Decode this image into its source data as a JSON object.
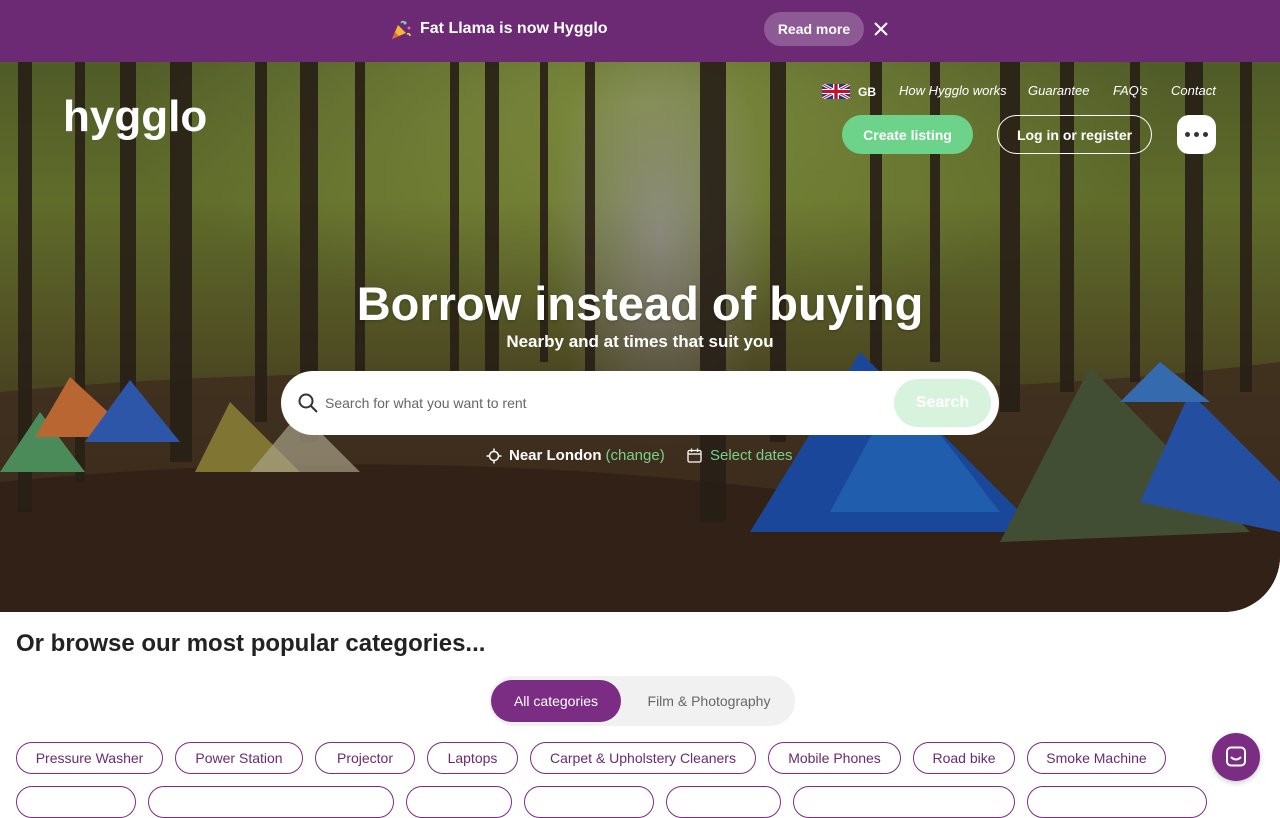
{
  "announcement": {
    "emoji": "party-popper-icon",
    "text": "Fat Llama is now Hygglo",
    "read_more": "Read more"
  },
  "header": {
    "logo": "hygglo",
    "region": "GB",
    "nav": [
      "How Hygglo works",
      "Guarantee",
      "FAQ's",
      "Contact"
    ],
    "create_listing": "Create listing",
    "login": "Log in or register"
  },
  "hero": {
    "headline": "Borrow instead of buying",
    "subhead": "Nearby and at times that suit you",
    "search_placeholder": "Search for what you want to rent",
    "search_button": "Search",
    "near_label": "Near London",
    "change_label": "(change)",
    "dates_label": "Select dates"
  },
  "categories": {
    "heading": "Or browse our most popular categories...",
    "tabs": [
      "All categories",
      "Film & Photography"
    ],
    "chips_row1": [
      "Pressure Washer",
      "Power Station",
      "Projector",
      "Laptops",
      "Carpet & Upholstery Cleaners",
      "Mobile Phones",
      "Road bike",
      "Smoke Machine"
    ]
  },
  "colors": {
    "brand_purple": "#6b2a73",
    "accent_green": "#6dd38a"
  }
}
